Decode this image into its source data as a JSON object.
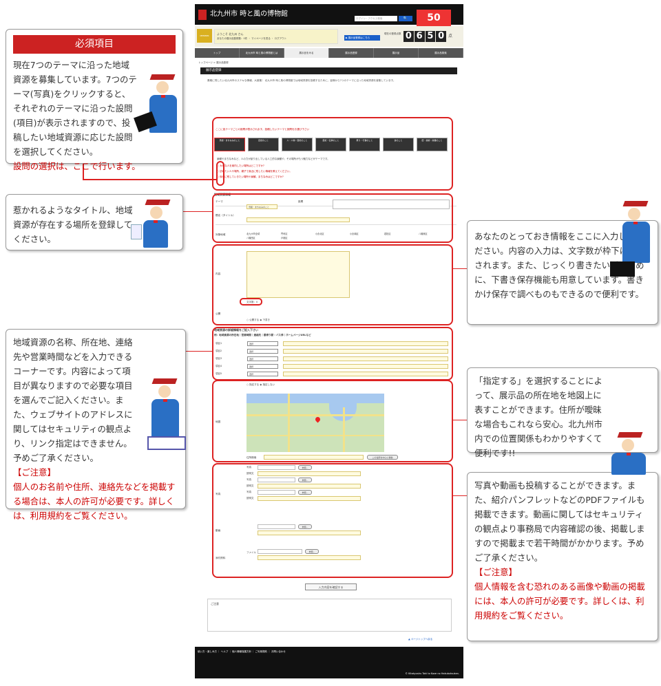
{
  "callouts": {
    "required": {
      "heading": "必須項目",
      "body": "現在7つのテーマに沿った地域資源を募集しています。7つのテーマ(写真)をクリックすると、それぞれのテーマに沿った設問(項目)が表示されますので、投稿したい地域資源に応じた設問を選択してください。",
      "note": "設問の選択は、ここで行います。"
    },
    "title": {
      "body": "惹かれるようなタイトル、地域資源が存在する場所を登録してください。"
    },
    "content": {
      "body": "あなたのとっておき情報をここに入力してください。内容の入力は、文字数が枠下に表示されます。また、じっくり書きたい派のために、下書き保存機能も用意しています。書きかけ保存で調べものもできるので便利です。"
    },
    "details": {
      "body": "地域資源の名称、所在地、連絡先や営業時間などを入力できるコーナーです。内容によって項目が異なりますので必要な項目を選んでご記入ください。また、ウェブサイトのアドレスに関してはセキュリティの観点より、リンク指定はできません。予めご了承ください。",
      "note_head": "【ご注意】",
      "note": "個人のお名前や住所、連絡先などを掲載する場合は、本人の許可が必要です。詳しくは、利用規約をご覧ください。"
    },
    "map": {
      "body": "「指定する」を選択することによって、展示品の所在地を地図上に表すことができます。住所が曖昧な場合もこれなら安心。北九州市内での位置関係もわかりやすくて便利です!!"
    },
    "media": {
      "body": "写真や動画も投稿することができます。また、紹介パンフレットなどのPDFファイルも掲載できます。動画に関してはセキュリティの観点より事務局で内容確認の後、掲載しますので掲載まで若干時間がかかります。予めご了承ください。",
      "note_head": "【ご注意】",
      "note": "個人情報を含む恐れのある画像や動画の掲載には、本人の許可が必要です。詳しくは、利用規約をご覧ください。"
    }
  },
  "site": {
    "logo": "北九州市 時と風の博物館",
    "search_placeholder": "ログイン・アクセス検索",
    "search_button": "🔍",
    "anniversary": "50",
    "member_label": "MEMBER",
    "welcome": "ようこそ 北九州 さん",
    "user_links": "あなたの展示品登録数：0件 ・ マイページを見る ・ ログアウト",
    "counter_caption": "現在の登録点数",
    "counter_digits": [
      "0",
      "6",
      "5",
      "0"
    ],
    "counter_unit": "点",
    "entry_button": "▶ 展示品登録はこちら",
    "nav": [
      "トップ",
      "北九州市 時と風の博物館とは",
      "展示品をみる",
      "展示品登録",
      "展示品",
      "展示品検索"
    ],
    "breadcrumb": "トップページ > 展示品登録",
    "page_title": "展示品登録",
    "intro": "素敵に残したい北九州市のステキな情報、大募集！ 北九州市 時と風の博物館では地域資源を投稿するために、皆様から7つのテーマに沿った地域資源を募集しています。",
    "theme_prompt": "ここに各テーマごとの設問が表示されます。投稿したいテーマと設問をお選び下さい",
    "themes": [
      "景観・まちなみのこと",
      "自然のこと",
      "人・人物・歴史のこと",
      "歴史・伝承のこと",
      "祭り・行事のこと",
      "食のこと",
      "匠・技術・産業のこと"
    ],
    "theme_desc": "景観やまちなみなど、人の力が創り出している人工的な景観や、その場所がもつ魅力などがテーマです。",
    "questions": [
      "○ 大切な人を案内したい場所はどこですか?",
      "○ 訪れたい人や場所、親子で身近に残したい情報を教えてください。",
      "○ 後世に残していきたい場所や景観、まちなみはどこですか?"
    ],
    "section_basic": "地域資源情報",
    "label_theme": "テーマ",
    "theme_value": "景観・まちなみのこと",
    "label_question": "設問",
    "label_title": "題名（タイトル）",
    "label_area": "対象地域",
    "areas": [
      "北九州市全域",
      "門司区",
      "小倉北区",
      "小倉南区",
      "若松区",
      "八幡東区",
      "八幡西区",
      "戸畑区"
    ],
    "label_content": "内容",
    "char_count": "文字数：0",
    "label_public": "公開",
    "public_option": "○ 公開する ◉ 下書き",
    "section_detail": "地域資源の詳細情報をご記入下さい",
    "detail_hint": "例：地域資源の所在地｜営業時間｜連絡先｜最寄り駅・バス停｜ホームページURLなど",
    "detail_rows": [
      "項目1",
      "項目2",
      "項目3",
      "項目4",
      "項目5"
    ],
    "detail_select": "選択",
    "label_map": "地図",
    "map_option": "○ 指定する ◉ 指定しない",
    "map_button": "この住所を中心に移動",
    "label_address": "住所検索",
    "label_photo": "写真",
    "photo_fields": [
      "写真",
      "説明文",
      "写真",
      "説明文",
      "写真",
      "説明文"
    ],
    "browse": "参照...",
    "label_video": "動画",
    "label_attach": "添付資料",
    "attach_field": "ファイル",
    "submit": "入力内容を確認する",
    "notes_title": "ご注意",
    "pagetop": "▲ ページトップへ戻る",
    "footer_links": "使い方・楽しみ方 ｜ ヘルプ ｜ 個人情報保護方針 ｜ ご利用規約 ｜ お問い合わせ",
    "footer_copy": "© Kitakyushu Toki to Kaze no Hakubutsukan."
  }
}
